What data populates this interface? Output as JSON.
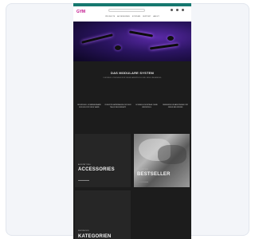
{
  "header": {
    "logo": "GYM",
    "nav": [
      "Products",
      "Accessories",
      "Systems",
      "Support",
      "About"
    ]
  },
  "intro": {
    "title": "Das Modulare System",
    "subtitle": "Flexible Lösungen für jeden Anspruch und jede Umgebung"
  },
  "features": [
    "Individuell kombinierbare Module für jede Wand",
    "Robuste Materialien für den täglichen Einsatz",
    "Schnelle Montage ohne Werkzeug",
    "Passende Ergänzungen für jedes Bedürfnis"
  ],
  "tiles": [
    {
      "small": "Ausstattung",
      "title": "Accessories",
      "link": "Mehr"
    },
    {
      "small": "Kollektion",
      "title": "Bestseller",
      "link": "Mehr"
    },
    {
      "small": "Inspiration",
      "title": "Kategorien",
      "link": "Mehr"
    }
  ],
  "colors": {
    "topbar": "#16786f",
    "accent": "#c0108a",
    "background": "#1c1c1c"
  }
}
